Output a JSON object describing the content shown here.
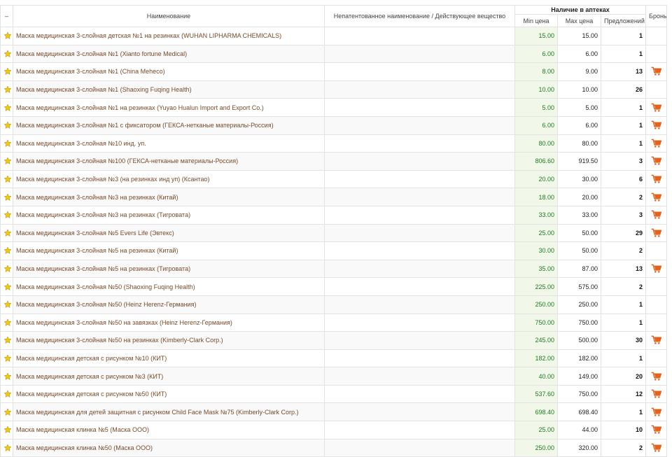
{
  "header": {
    "sort_mark": "–",
    "name": "Наименование",
    "inn": "Непатентованное наименование / Действующее вещество",
    "availability": "Наличие в аптеках",
    "min_price": "Min цена",
    "max_price": "Max цена",
    "offers": "Предложений",
    "reserve": "Бронь"
  },
  "colors": {
    "star": "#f3c813",
    "cart": "#e0641e",
    "min_price": "#1e7a1e",
    "name": "#7a4a2a"
  },
  "icons": {
    "favorite": "star-icon",
    "reserve": "cart-icon"
  },
  "rows": [
    {
      "name": "Маска медицинская 3-слойная детская №1 на резинках (WUHAN LIPHARMA CHEMICALS)",
      "inn": "",
      "min": "15.00",
      "max": "15.00",
      "count": "1",
      "cart": false
    },
    {
      "name": "Маска медицинская 3-слойная №1 (Xianto fortune Medical)",
      "inn": "",
      "min": "6.00",
      "max": "6.00",
      "count": "1",
      "cart": false
    },
    {
      "name": "Маска медицинская 3-слойная №1 (China Meheco)",
      "inn": "",
      "min": "8.00",
      "max": "9.00",
      "count": "13",
      "cart": true
    },
    {
      "name": "Маска медицинская 3-слойная №1 (Shaoxing Fuqing Health)",
      "inn": "",
      "min": "10.00",
      "max": "10.00",
      "count": "26",
      "cart": false
    },
    {
      "name": "Маска медицинская 3-слойная №1 на резинках (Yuyao Hualun Import and Export Co.)",
      "inn": "",
      "min": "5.00",
      "max": "5.00",
      "count": "1",
      "cart": true
    },
    {
      "name": "Маска медицинская 3-слойная №1 с фиксатором (ГЕКСА-нетканые материалы-Россия)",
      "inn": "",
      "min": "6.00",
      "max": "6.00",
      "count": "1",
      "cart": true
    },
    {
      "name": "Маска медицинская 3-слойная №10 инд. уп.",
      "inn": "",
      "min": "80.00",
      "max": "80.00",
      "count": "1",
      "cart": true
    },
    {
      "name": "Маска медицинская 3-слойная №100 (ГЕКСА-нетканые материалы-Россия)",
      "inn": "",
      "min": "806.60",
      "max": "919.50",
      "count": "3",
      "cart": true
    },
    {
      "name": "Маска медицинская 3-слойная №3 (на резинках инд уп) (Ксантао)",
      "inn": "",
      "min": "20.00",
      "max": "30.00",
      "count": "6",
      "cart": true
    },
    {
      "name": "Маска медицинская 3-слойная №3 на резинках (Китай)",
      "inn": "",
      "min": "18.00",
      "max": "20.00",
      "count": "2",
      "cart": true
    },
    {
      "name": "Маска медицинская 3-слойная №3 на резинках (Тигровата)",
      "inn": "",
      "min": "33.00",
      "max": "33.00",
      "count": "3",
      "cart": true
    },
    {
      "name": "Маска медицинская 3-слойная №5 Evers Life (Эвтекс)",
      "inn": "",
      "min": "25.00",
      "max": "50.00",
      "count": "29",
      "cart": true
    },
    {
      "name": "Маска медицинская 3-слойная №5 на резинках (Китай)",
      "inn": "",
      "min": "30.00",
      "max": "50.00",
      "count": "2",
      "cart": false
    },
    {
      "name": "Маска медицинская 3-слойная №5 на резинках (Тигровата)",
      "inn": "",
      "min": "35.00",
      "max": "87.00",
      "count": "13",
      "cart": true
    },
    {
      "name": "Маска медицинская 3-слойная №50 (Shaoxing Fuqing Health)",
      "inn": "",
      "min": "225.00",
      "max": "575.00",
      "count": "2",
      "cart": false
    },
    {
      "name": "Маска медицинская 3-слойная №50 (Heinz Herenz-Германия)",
      "inn": "",
      "min": "250.00",
      "max": "250.00",
      "count": "1",
      "cart": false
    },
    {
      "name": "Маска медицинская 3-слойная №50 на завязках (Heinz Herenz-Германия)",
      "inn": "",
      "min": "750.00",
      "max": "750.00",
      "count": "1",
      "cart": false
    },
    {
      "name": "Маска медицинская 3-слойная №50 на резинках (Kimberly-Clark Corp.)",
      "inn": "",
      "min": "245.00",
      "max": "500.00",
      "count": "30",
      "cart": true
    },
    {
      "name": "Маска медицинская детская с рисунком №10 (КИТ)",
      "inn": "",
      "min": "182.00",
      "max": "182.00",
      "count": "1",
      "cart": false
    },
    {
      "name": "Маска медицинская детская с рисунком №3 (КИТ)",
      "inn": "",
      "min": "40.00",
      "max": "149.00",
      "count": "20",
      "cart": true
    },
    {
      "name": "Маска медицинская детская с рисунком №50 (КИТ)",
      "inn": "",
      "min": "537.60",
      "max": "750.00",
      "count": "12",
      "cart": true
    },
    {
      "name": "Маска медицинская для детей защитная с рисунком Child Face Mask №75 (Kimberly-Clark Corp.)",
      "inn": "",
      "min": "698.40",
      "max": "698.40",
      "count": "1",
      "cart": true
    },
    {
      "name": "Маска медицинская клинка №5 (Маска ООО)",
      "inn": "",
      "min": "25.00",
      "max": "44.00",
      "count": "10",
      "cart": true
    },
    {
      "name": "Маска медицинская клинка №50 (Маска ООО)",
      "inn": "",
      "min": "250.00",
      "max": "320.00",
      "count": "2",
      "cart": true
    }
  ]
}
